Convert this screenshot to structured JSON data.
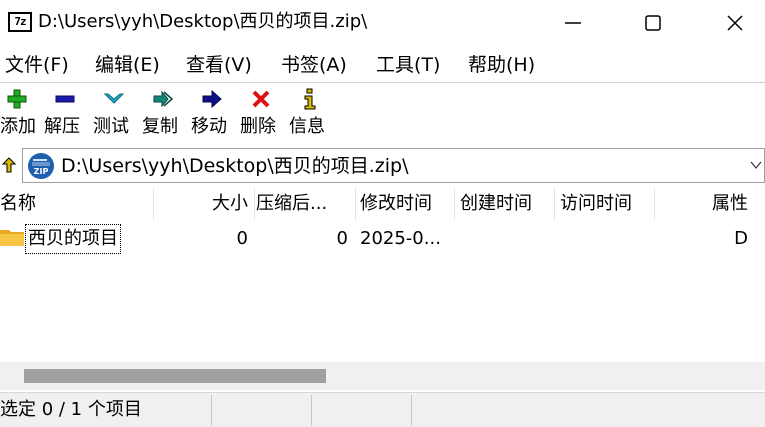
{
  "window": {
    "icon_text": "7z",
    "title": "D:\\Users\\yyh\\Desktop\\西贝的项目.zip\\"
  },
  "menu": [
    {
      "label": "文件(F)"
    },
    {
      "label": "编辑(E)"
    },
    {
      "label": "查看(V)"
    },
    {
      "label": "书签(A)"
    },
    {
      "label": "工具(T)"
    },
    {
      "label": "帮助(H)"
    }
  ],
  "toolbar": [
    {
      "label": "添加",
      "icon": "plus-icon",
      "color": "#22aa22"
    },
    {
      "label": "解压",
      "icon": "minus-icon",
      "color": "#1a1aaa"
    },
    {
      "label": "测试",
      "icon": "check-chevron-icon",
      "color": "#22aacc"
    },
    {
      "label": "复制",
      "icon": "double-arrow-icon",
      "color": "#118877"
    },
    {
      "label": "移动",
      "icon": "arrow-right-icon",
      "color": "#10108a"
    },
    {
      "label": "删除",
      "icon": "x-icon",
      "color": "#dd1111"
    },
    {
      "label": "信息",
      "icon": "info-icon",
      "color": "#ddbb00"
    }
  ],
  "address": {
    "path": "D:\\Users\\yyh\\Desktop\\西贝的项目.zip\\",
    "icon_label": "ZIP"
  },
  "columns": [
    {
      "label": "名称"
    },
    {
      "label": "大小"
    },
    {
      "label": "压缩后..."
    },
    {
      "label": "修改时间"
    },
    {
      "label": "创建时间"
    },
    {
      "label": "访问时间"
    },
    {
      "label": "属性"
    }
  ],
  "rows": [
    {
      "name": "西贝的项目",
      "size": "0",
      "packed": "0",
      "modified": "2025-0...",
      "created": "",
      "accessed": "",
      "attributes": "D"
    }
  ],
  "status": {
    "selection": "选定 0 / 1 个项目"
  }
}
